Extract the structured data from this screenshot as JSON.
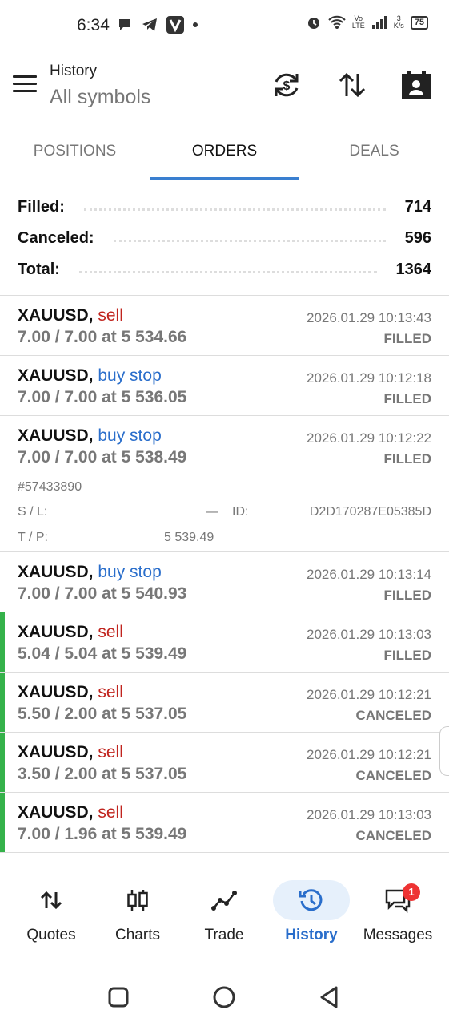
{
  "status_bar": {
    "time": "6:34",
    "battery": "75",
    "net_speed_top": "3",
    "net_speed_bottom": "K/s",
    "vo_top": "Vo",
    "vo_bottom": "LTE"
  },
  "header": {
    "subtitle": "History",
    "title": "All symbols"
  },
  "tabs": [
    {
      "label": "POSITIONS",
      "active": false
    },
    {
      "label": "ORDERS",
      "active": true
    },
    {
      "label": "DEALS",
      "active": false
    }
  ],
  "summary": {
    "filled_label": "Filled:",
    "filled_value": "714",
    "canceled_label": "Canceled:",
    "canceled_value": "596",
    "total_label": "Total:",
    "total_value": "1364"
  },
  "orders": [
    {
      "symbol": "XAUUSD,",
      "type": "sell",
      "volume": "7.00 / 7.00 at 5 534.66",
      "time": "2026.01.29 10:13:43",
      "status": "FILLED"
    },
    {
      "symbol": "XAUUSD,",
      "type": "buy stop",
      "volume": "7.00 / 7.00 at 5 536.05",
      "time": "2026.01.29 10:12:18",
      "status": "FILLED"
    },
    {
      "symbol": "XAUUSD,",
      "type": "buy stop",
      "volume": "7.00 / 7.00 at 5 538.49",
      "time": "2026.01.29 10:12:22",
      "status": "FILLED",
      "details": {
        "ticket": "#57433890",
        "sl_label": "S / L:",
        "sl_value": "—",
        "id_label": "ID:",
        "id_value": "D2D170287E05385D",
        "tp_label": "T / P:",
        "tp_value": "5 539.49"
      }
    },
    {
      "symbol": "XAUUSD,",
      "type": "buy stop",
      "volume": "7.00 / 7.00 at 5 540.93",
      "time": "2026.01.29 10:13:14",
      "status": "FILLED"
    },
    {
      "symbol": "XAUUSD,",
      "type": "sell",
      "volume": "5.04 / 5.04 at 5 539.49",
      "time": "2026.01.29 10:13:03",
      "status": "FILLED"
    },
    {
      "symbol": "XAUUSD,",
      "type": "sell",
      "volume": "5.50 / 2.00 at 5 537.05",
      "time": "2026.01.29 10:12:21",
      "status": "CANCELED"
    },
    {
      "symbol": "XAUUSD,",
      "type": "sell",
      "volume": "3.50 / 2.00 at 5 537.05",
      "time": "2026.01.29 10:12:21",
      "status": "CANCELED"
    },
    {
      "symbol": "XAUUSD,",
      "type": "sell",
      "volume": "7.00 / 1.96 at 5 539.49",
      "time": "2026.01.29 10:13:03",
      "status": "CANCELED"
    }
  ],
  "bottom_nav": [
    {
      "label": "Quotes",
      "icon": "quotes-icon"
    },
    {
      "label": "Charts",
      "icon": "charts-icon"
    },
    {
      "label": "Trade",
      "icon": "trade-icon"
    },
    {
      "label": "History",
      "icon": "history-icon",
      "active": true
    },
    {
      "label": "Messages",
      "icon": "messages-icon",
      "badge": "1"
    }
  ],
  "colors": {
    "accent": "#2a6ecb",
    "sell": "#c0241e",
    "buy": "#2a6ecb",
    "marker": "#35b24a"
  }
}
